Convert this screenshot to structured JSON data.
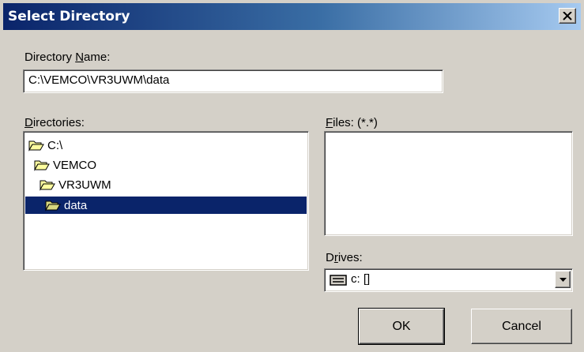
{
  "window": {
    "title": "Select Directory",
    "close_label": "×"
  },
  "directory_name": {
    "label_prefix": "Directory ",
    "label_accel": "N",
    "label_suffix": "ame:",
    "value": "C:\\VEMCO\\VR3UWM\\data"
  },
  "directories": {
    "label_accel": "D",
    "label_suffix": "irectories:",
    "items": [
      {
        "name": "C:\\",
        "icon": "open-folder-icon",
        "selected": false
      },
      {
        "name": "VEMCO",
        "icon": "open-folder-icon",
        "selected": false
      },
      {
        "name": "VR3UWM",
        "icon": "open-folder-icon",
        "selected": false
      },
      {
        "name": "data",
        "icon": "open-folder-icon",
        "selected": true
      }
    ]
  },
  "files": {
    "label_accel": "F",
    "label_suffix": "iles: (*.*)"
  },
  "drives": {
    "label_prefix": "D",
    "label_accel": "r",
    "label_suffix": "ives:",
    "value": "c: []",
    "icon": "drive-icon"
  },
  "buttons": {
    "ok": "OK",
    "cancel": "Cancel"
  },
  "colors": {
    "titlebar_start": "#0a246a",
    "titlebar_end": "#a6caf0",
    "selection": "#0a246a",
    "face": "#d4d0c8"
  }
}
